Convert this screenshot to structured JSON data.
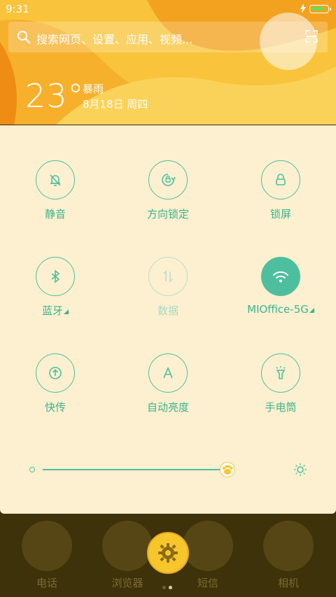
{
  "status": {
    "time": "9:31",
    "battery_level": 0.85
  },
  "search": {
    "placeholder": "搜索网页、设置、应用、视频..."
  },
  "weather": {
    "temperature": "23°",
    "condition": "暴雨",
    "date": "8月18日 周四"
  },
  "toggles": [
    {
      "label": "静音",
      "icon": "bell-off-icon",
      "state": "off"
    },
    {
      "label": "方向锁定",
      "icon": "rotation-lock-icon",
      "state": "off"
    },
    {
      "label": "锁屏",
      "icon": "lock-icon",
      "state": "off"
    },
    {
      "label": "蓝牙",
      "icon": "bluetooth-icon",
      "state": "off",
      "has_menu": true
    },
    {
      "label": "数据",
      "icon": "mobile-data-icon",
      "state": "disabled"
    },
    {
      "label": "MIOffice-5G",
      "icon": "wifi-icon",
      "state": "on",
      "has_menu": true
    },
    {
      "label": "快传",
      "icon": "transfer-icon",
      "state": "off"
    },
    {
      "label": "自动亮度",
      "icon": "auto-brightness-icon",
      "state": "off"
    },
    {
      "label": "手电筒",
      "icon": "flashlight-icon",
      "state": "off"
    }
  ],
  "brightness": {
    "level": 0.66
  },
  "dock": {
    "apps": [
      {
        "name": "电话",
        "icon": "phone-icon"
      },
      {
        "name": "浏览器",
        "icon": "browser-icon"
      },
      {
        "name": "短信",
        "icon": "messages-icon"
      },
      {
        "name": "相机",
        "icon": "camera-icon"
      }
    ],
    "pages": 2,
    "active_page": 2
  },
  "colors": {
    "accent": "#4dbf9e",
    "panel": "#fcf0d0",
    "header": "#f6b92a"
  }
}
